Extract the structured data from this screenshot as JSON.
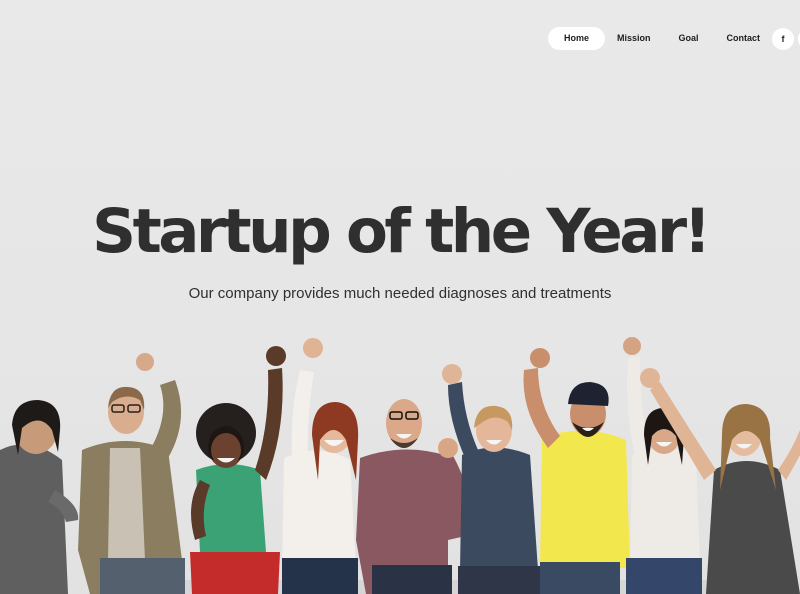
{
  "nav": {
    "items": [
      {
        "label": "Home",
        "active": true
      },
      {
        "label": "Mission",
        "active": false
      },
      {
        "label": "Goal",
        "active": false
      },
      {
        "label": "Contact",
        "active": false
      }
    ],
    "social": [
      {
        "label": "f",
        "icon": "facebook-icon"
      },
      {
        "label": "",
        "icon": "social-icon"
      }
    ]
  },
  "hero": {
    "title": "Startup of the Year!",
    "subtitle": "Our company provides much needed diagnoses and treatments"
  },
  "colors": {
    "background": "#e7e7e7",
    "text": "#2f2f2f",
    "nav_active_bg": "#ffffff"
  }
}
